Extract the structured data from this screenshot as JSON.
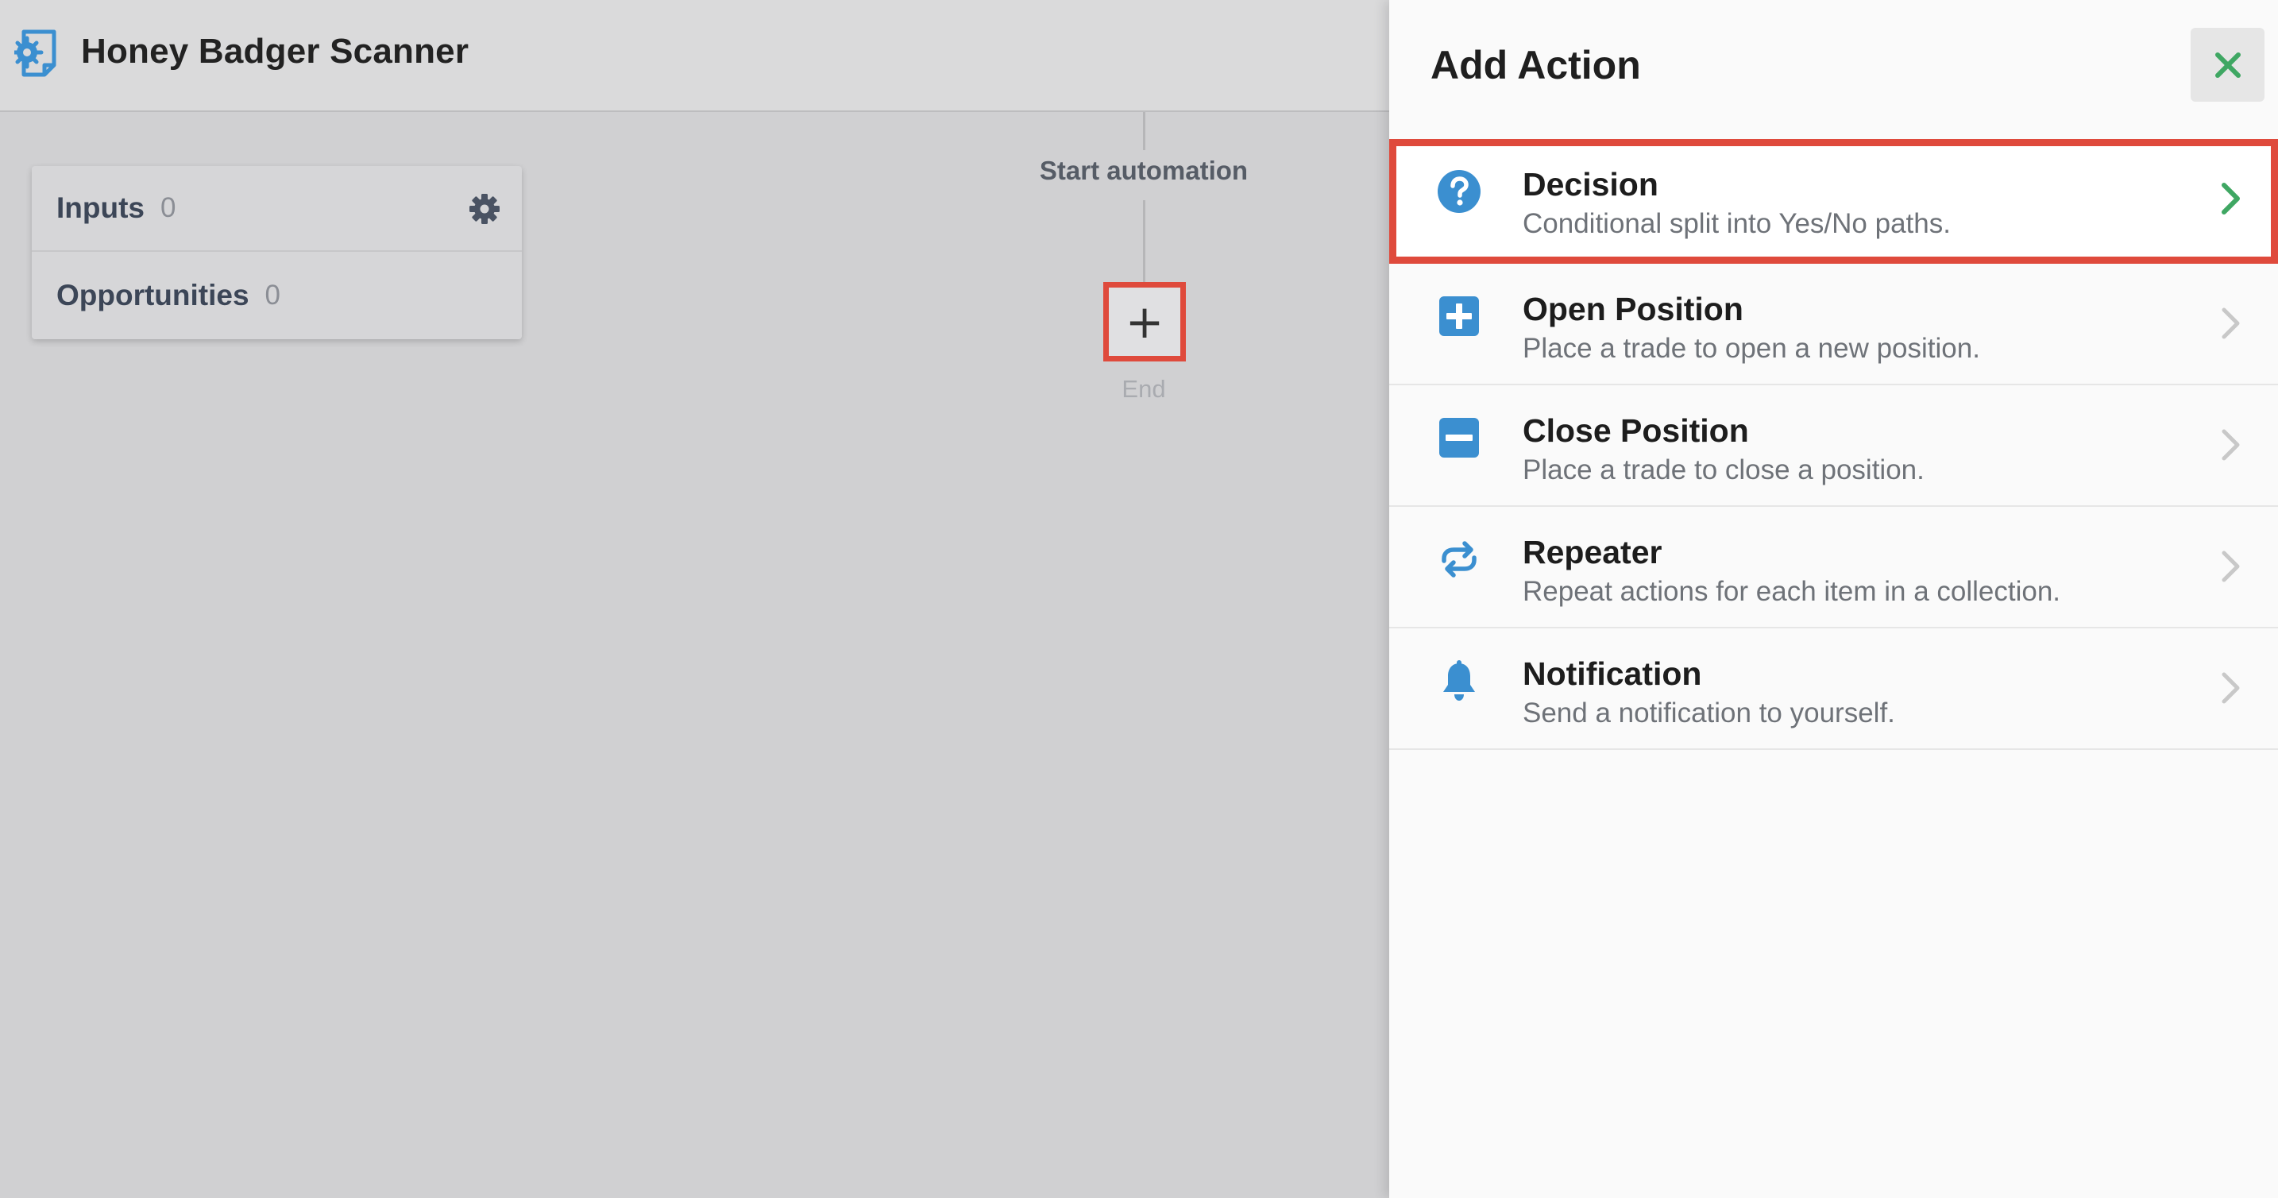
{
  "app": {
    "title": "Honey Badger Scanner",
    "icon": "document-gear-icon"
  },
  "info_card": {
    "rows": [
      {
        "label": "Inputs",
        "count": "0"
      },
      {
        "label": "Opportunities",
        "count": "0"
      }
    ],
    "settings_icon": "gear-icon"
  },
  "flow": {
    "start_label": "Start automation",
    "add_symbol": "+",
    "end_label": "End"
  },
  "panel": {
    "title": "Add Action",
    "close_icon": "close-icon",
    "actions": [
      {
        "title": "Decision",
        "description": "Conditional split into Yes/No paths.",
        "icon": "question-circle-icon"
      },
      {
        "title": "Open Position",
        "description": "Place a trade to open a new position.",
        "icon": "plus-square-icon"
      },
      {
        "title": "Close Position",
        "description": "Place a trade to close a position.",
        "icon": "minus-square-icon"
      },
      {
        "title": "Repeater",
        "description": "Repeat actions for each item in a collection.",
        "icon": "repeat-icon"
      },
      {
        "title": "Notification",
        "description": "Send a notification to yourself.",
        "icon": "bell-icon"
      }
    ]
  },
  "colors": {
    "accent_blue": "#3b8fd0",
    "highlight_red": "#df4a3c",
    "close_green": "#3fa763",
    "chevron_green": "#3fa763",
    "chevron_gray": "#c8c8c8"
  }
}
